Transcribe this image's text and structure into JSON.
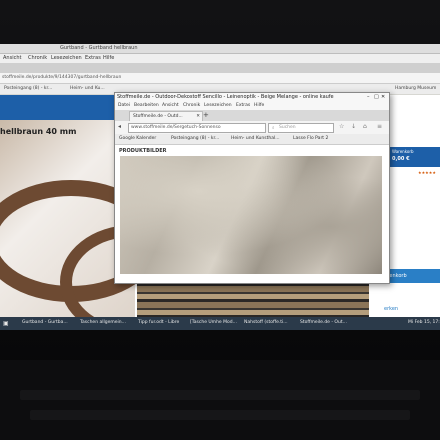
{
  "back_browser": {
    "title": "Gurtband - Gurtband hellbraun",
    "menu": [
      "Ansicht",
      "Chronik",
      "Lesezeichen",
      "Extras",
      "Hilfe"
    ],
    "url": "stoffmeile.de/produkte/9/144307/gurtband-hellbraun",
    "bookmarks": [
      "Posteingang (8) - kr...",
      "Heim- und Ku..."
    ],
    "product_title": "hellbraun 40 mm",
    "price_label": "Warenkorb",
    "price_value": "0,00 €",
    "side_links": [
      "lenkorb",
      "erken",
      "Wunschzettel"
    ],
    "bookmark_right": "Hamburg Museum"
  },
  "front_browser": {
    "title": "Stoffmeile.de - Outdoor-Dekostoff Sencillo - Leinenoptik - Beige Melange - online kaufe",
    "menu": [
      "Datei",
      "Bearbeiten",
      "Ansicht",
      "Chronik",
      "Lesezeichen",
      "Extras",
      "Hilfe"
    ],
    "tab_label": "Stoffmeile.de - Outd...",
    "url": "www.stoffmeile.de/Sergetuch-Sonnenso",
    "search_placeholder": "Suchen",
    "bookmarks": [
      "Google Kalender",
      "Posteingang (8) - kr...",
      "Heim- und Kunsthal...",
      "Lasse Flo Part 2"
    ],
    "section_label": "PRODUKTBILDER"
  },
  "taskbar": {
    "items": [
      "Gurtband - Gurtba...",
      "Taschen allgemein...",
      "Tipp fur.odt - Libre",
      "[Tasche Umhe Mod...",
      "Nahstoff (stoffe.ti...",
      "Stoffmeile.de - Out..."
    ],
    "clock": "Mi Feb 15, 17:"
  },
  "colors": {
    "accent": "#1d5fa8",
    "taskbar": "#2b3a4a"
  }
}
